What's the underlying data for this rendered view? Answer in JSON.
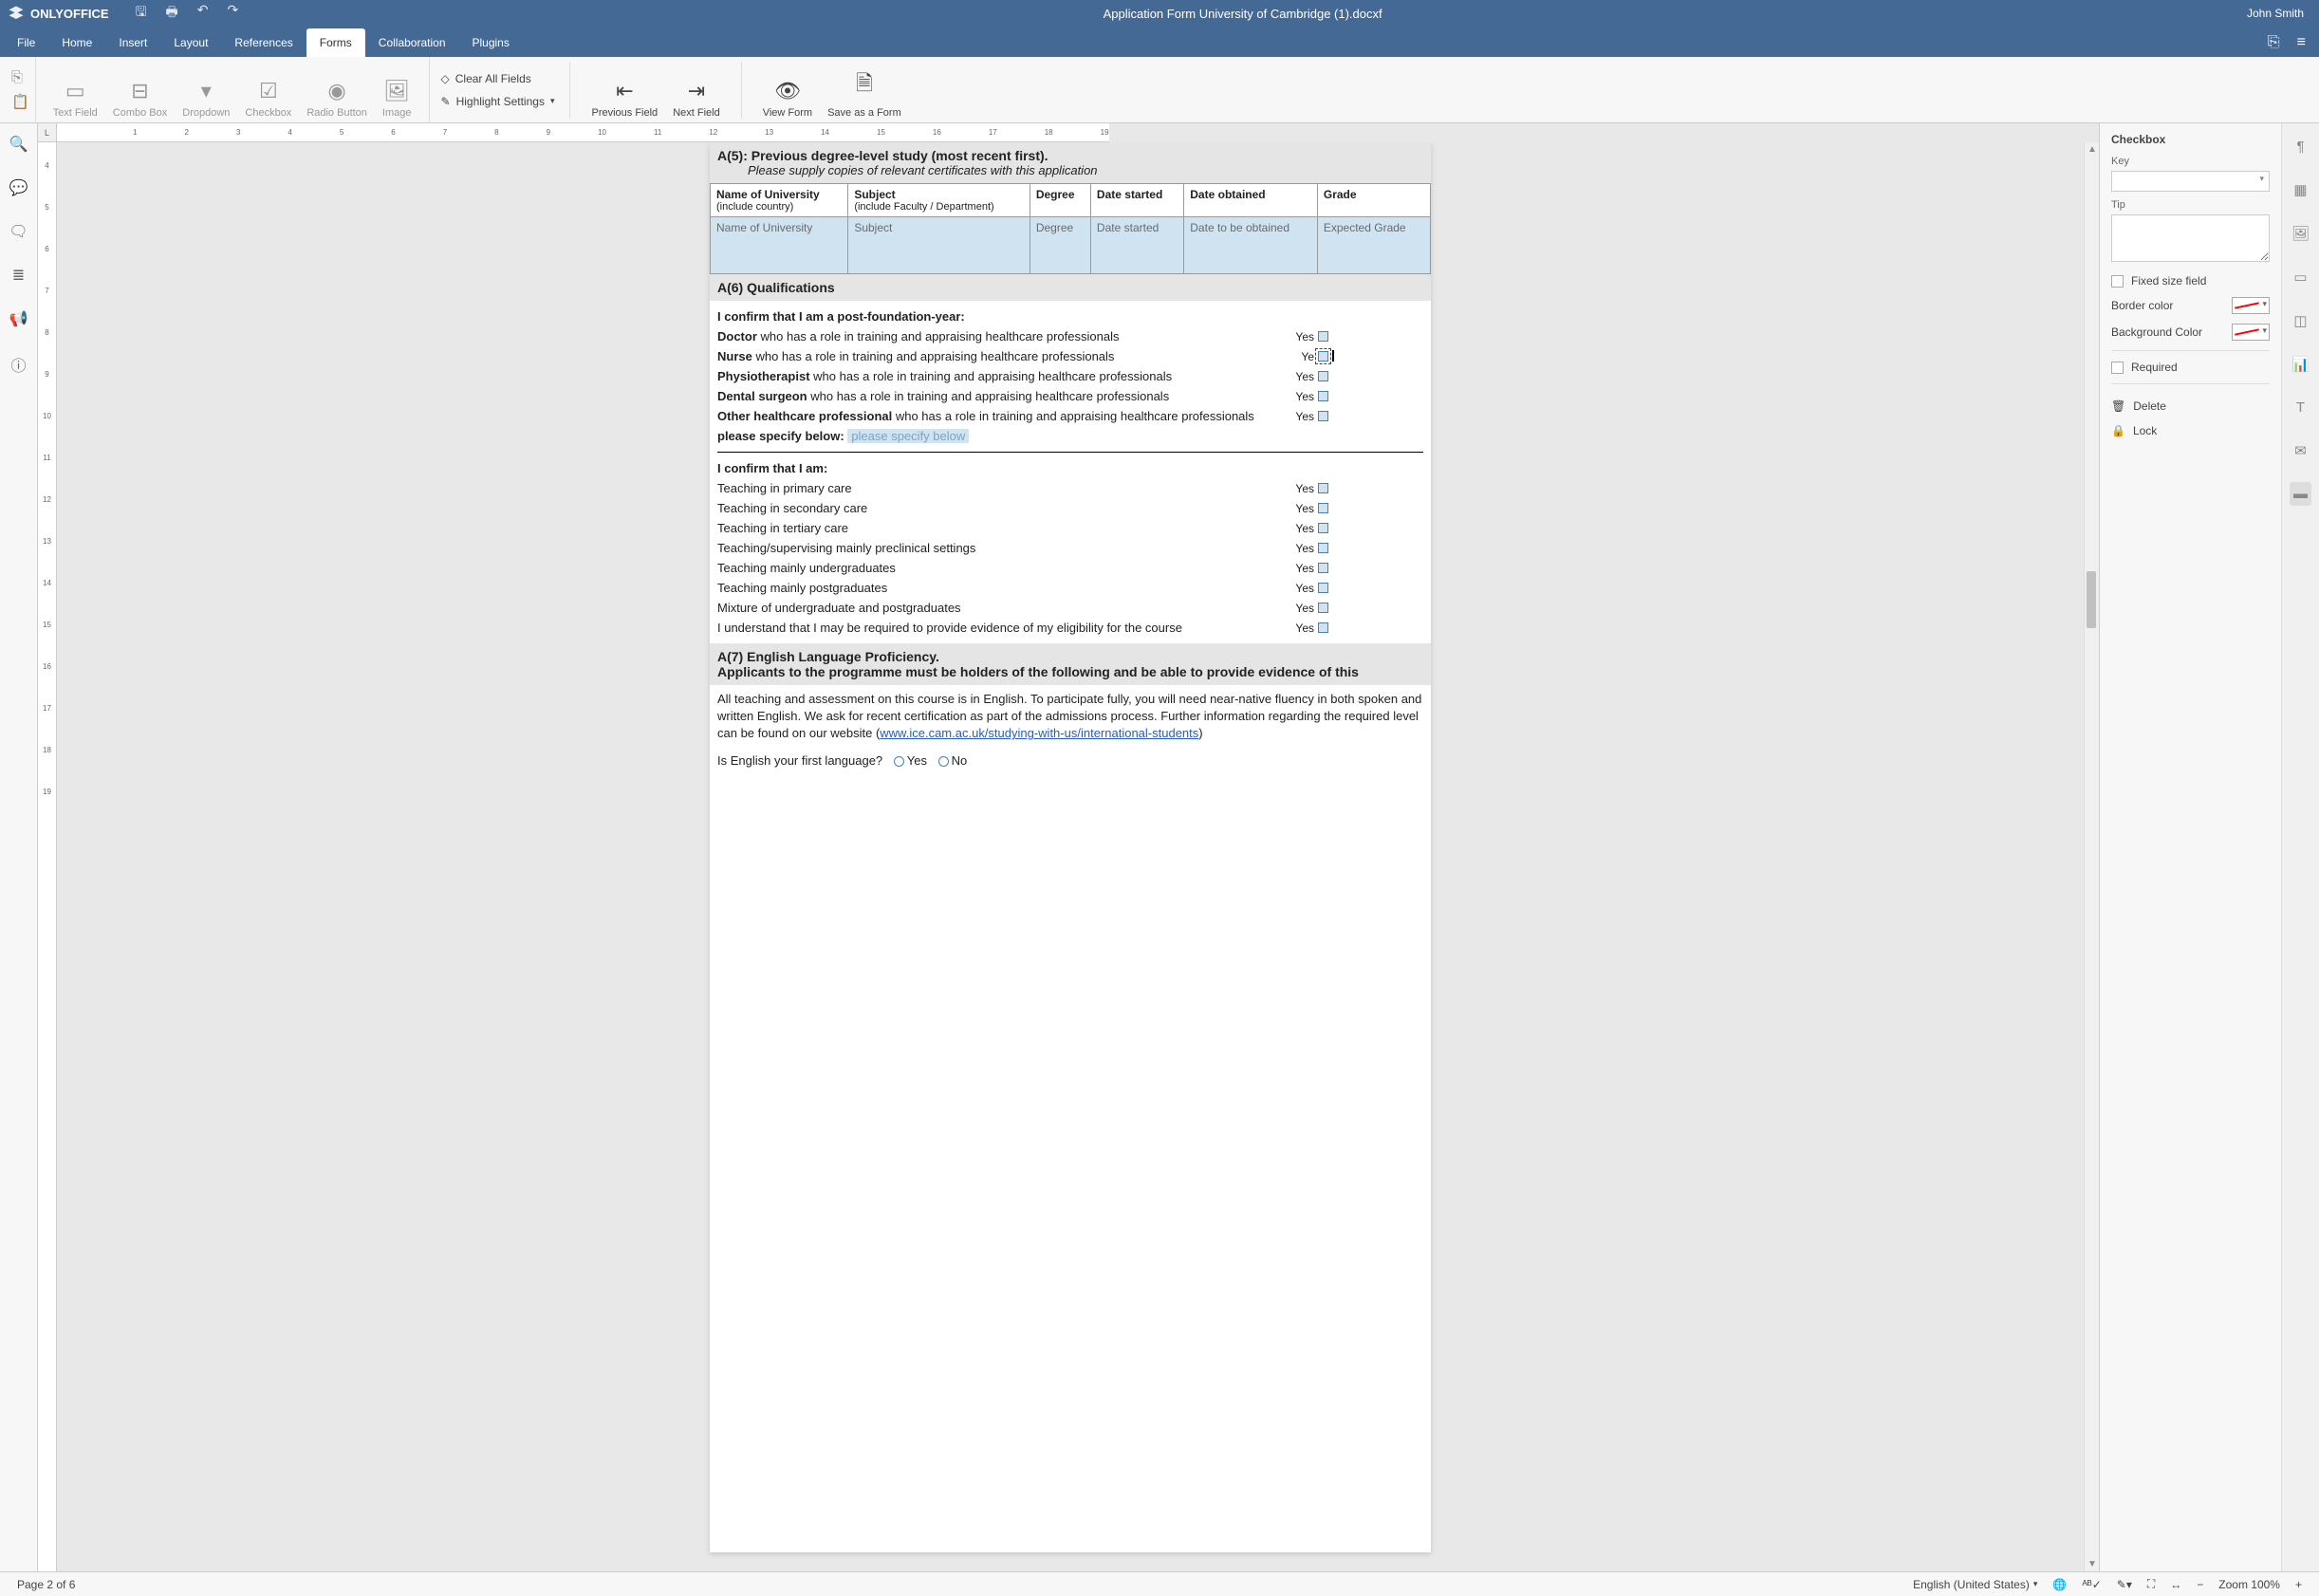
{
  "app": {
    "name": "ONLYOFFICE",
    "user": "John Smith",
    "doc_title": "Application Form University of Cambridge (1).docxf"
  },
  "menu": {
    "tabs": [
      "File",
      "Home",
      "Insert",
      "Layout",
      "References",
      "Forms",
      "Collaboration",
      "Plugins"
    ],
    "active": "Forms"
  },
  "toolbar": {
    "text_field": "Text Field",
    "combo_box": "Combo Box",
    "dropdown": "Dropdown",
    "checkbox": "Checkbox",
    "radio": "Radio Button",
    "image": "Image",
    "clear_all": "Clear All Fields",
    "highlight": "Highlight Settings",
    "prev_field": "Previous Field",
    "next_field": "Next Field",
    "view_form": "View Form",
    "save_form": "Save as a Form"
  },
  "hruler_marks": [
    "1",
    "2",
    "3",
    "4",
    "5",
    "6",
    "7",
    "8",
    "9",
    "10",
    "11",
    "12",
    "13",
    "14",
    "15",
    "16",
    "17",
    "18",
    "19"
  ],
  "vruler_marks": [
    "4",
    "5",
    "6",
    "7",
    "8",
    "9",
    "10",
    "11",
    "12",
    "13",
    "14",
    "15",
    "16",
    "17",
    "18",
    "19"
  ],
  "doc": {
    "a5": {
      "title": "A(5): Previous degree-level study (most recent first).",
      "sub": "Please supply copies of relevant certificates with this application",
      "headers": {
        "uni": "Name of University",
        "uni_sub": "(include country)",
        "subj": "Subject",
        "subj_sub": "(include Faculty / Department)",
        "degree": "Degree",
        "started": "Date started",
        "obtained": "Date obtained",
        "grade": "Grade"
      },
      "row": {
        "uni": "Name of University",
        "subj": "Subject",
        "degree": "Degree",
        "started": "Date started",
        "obtained": "Date to be obtained",
        "grade": "Expected Grade"
      }
    },
    "a6": {
      "title": "A(6) Qualifications",
      "confirm1": "I confirm that I am a post-foundation-year:",
      "roles": [
        {
          "b": "Doctor",
          "t": " who has a role in training and appraising healthcare professionals"
        },
        {
          "b": "Nurse",
          "t": " who has a role in training and appraising healthcare professionals"
        },
        {
          "b": "Physiotherapist",
          "t": "  who has a role in training and appraising healthcare professionals"
        },
        {
          "b": "Dental surgeon",
          "t": "  who has a role in training and appraising healthcare professionals"
        },
        {
          "b": "Other healthcare professional",
          "t": " who has a role in training and appraising healthcare professionals"
        }
      ],
      "specify_b": "please specify below:",
      "specify_ph": "please specify below",
      "yes": "Yes",
      "ye_cut": "Ye",
      "confirm2": "I confirm that I am:",
      "teaching": [
        "Teaching in primary care",
        "Teaching in secondary care",
        "Teaching in tertiary care",
        "Teaching/supervising mainly preclinical settings",
        "Teaching mainly undergraduates",
        "Teaching mainly postgraduates",
        "Mixture of undergraduate and postgraduates",
        "I understand that I may be required to provide evidence of my eligibility for the course"
      ]
    },
    "a7": {
      "title": "A(7) English Language Proficiency.",
      "sub": "Applicants to the programme must be holders of the following and be able to provide evidence of this",
      "body": "All teaching and assessment on this course is in English.  To participate fully, you will need near-native fluency in both spoken and written English. We ask for recent certification as part of the admissions process.  Further information regarding the required level can be found on our website (",
      "link": "www.ice.cam.ac.uk/studying-with-us/international-students",
      "body2": ")",
      "q": "Is English your first language?",
      "yes": "Yes",
      "no": "No"
    }
  },
  "rpanel": {
    "title": "Checkbox",
    "key": "Key",
    "tip": "Tip",
    "fixed": "Fixed size field",
    "border": "Border color",
    "bg": "Background Color",
    "required": "Required",
    "delete": "Delete",
    "lock": "Lock"
  },
  "status": {
    "page": "Page 2 of 6",
    "lang": "English (United States)",
    "zoom": "Zoom 100%"
  }
}
